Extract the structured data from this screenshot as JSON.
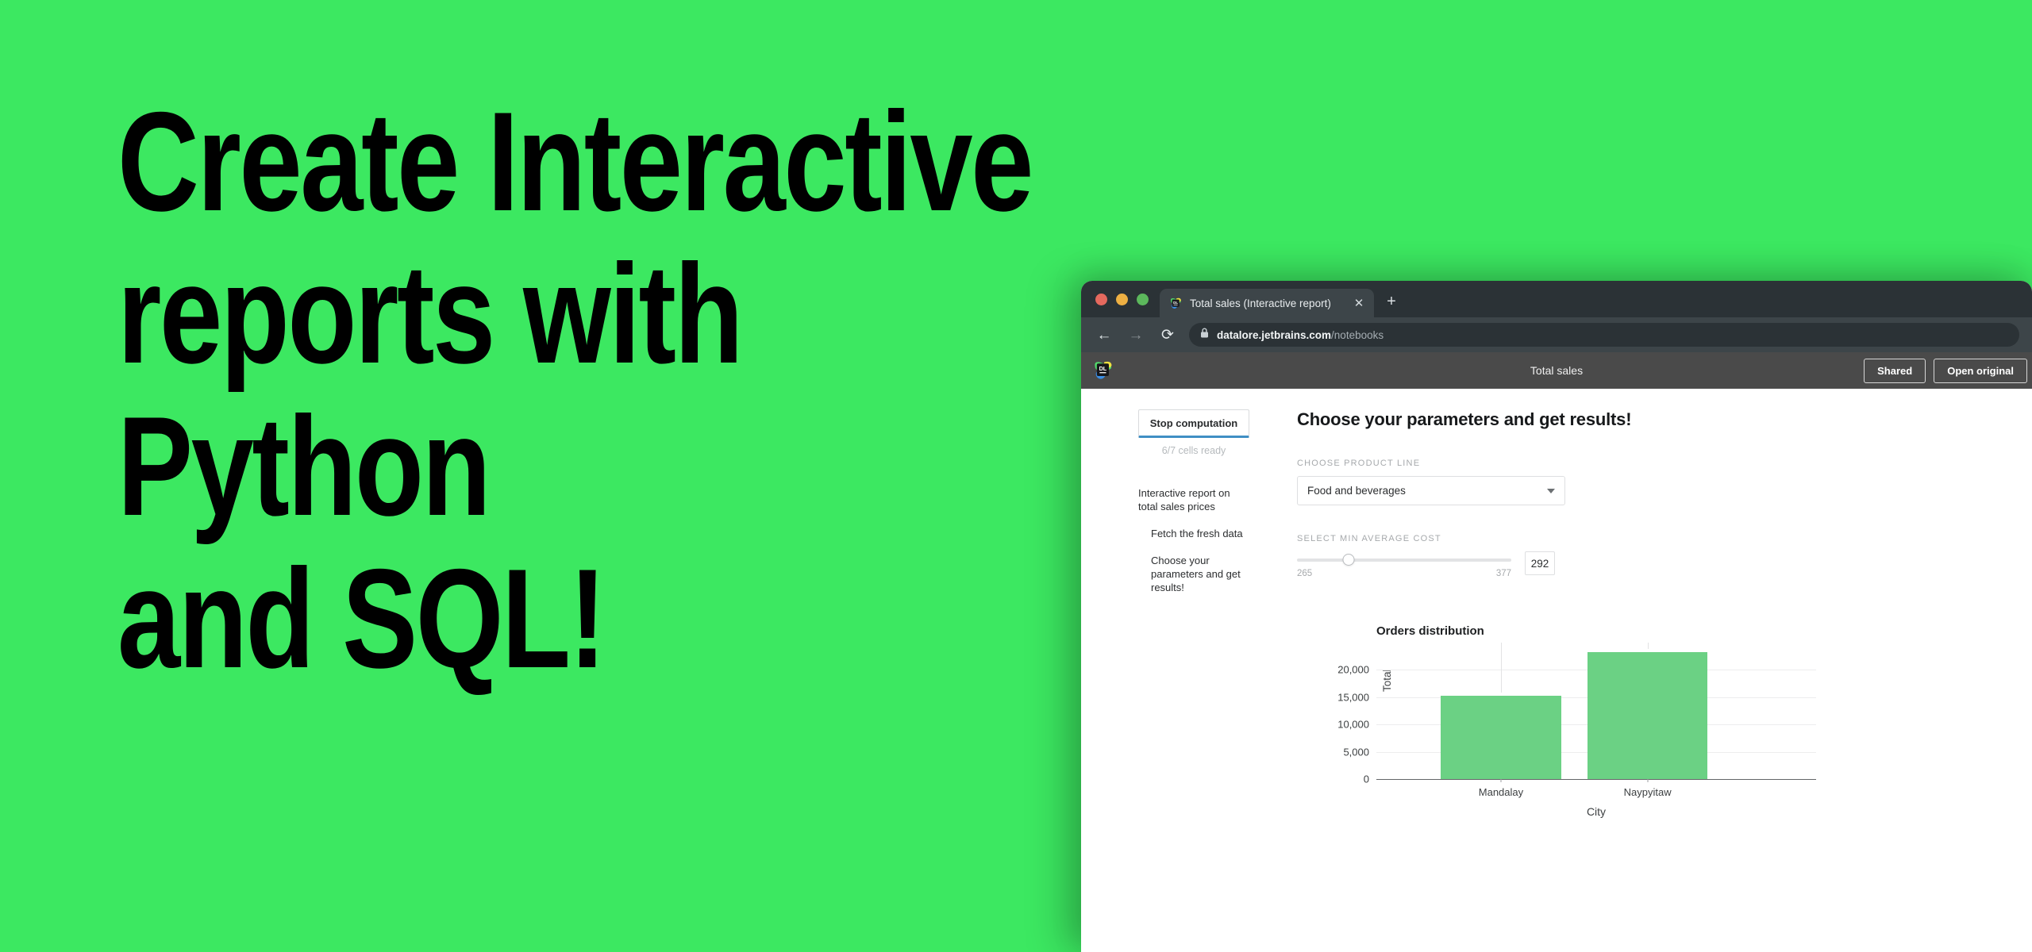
{
  "hero": {
    "lines": [
      "Create Interactive",
      "reports with",
      "Python",
      "and SQL!"
    ],
    "background_color": "#3ce861",
    "text_color": "#000000"
  },
  "browser": {
    "traffic_lights": [
      "close-red",
      "minimize-yellow",
      "maximize-green"
    ],
    "traffic_colors": {
      "red": "#e5695e",
      "yellow": "#eeb043",
      "green": "#5cb85c"
    },
    "tab": {
      "favicon": "datalore-icon",
      "title": "Total sales (Interactive report)",
      "close_label": "✕"
    },
    "new_tab_label": "+",
    "nav": {
      "back_label": "←",
      "forward_label": "→",
      "reload_label": "⟳"
    },
    "omnibox": {
      "lock_icon": "lock-icon",
      "domain": "datalore.jetbrains.com",
      "path": "/notebooks"
    },
    "chrome_color": "#2b3236",
    "toolbar_color": "#3d4549"
  },
  "app_header": {
    "logo": "datalore-logo",
    "title": "Total sales",
    "shared_label": "Shared",
    "open_original_label": "Open original",
    "background_color": "#4a4a4a"
  },
  "sidebar": {
    "stop_button_label": "Stop computation",
    "cells_ready": "6/7 cells ready",
    "toc": [
      {
        "level": 1,
        "label": "Interactive report on total sales prices"
      },
      {
        "level": 2,
        "label": "Fetch the fresh data"
      },
      {
        "level": 2,
        "label": "Choose your parameters and get results!"
      }
    ],
    "progress_color": "#3f8fc4"
  },
  "content": {
    "title": "Choose your parameters and get results!",
    "product_line": {
      "label": "CHOOSE PRODUCT LINE",
      "value": "Food and beverages",
      "caret": "chevron-down-icon"
    },
    "min_average_cost": {
      "label": "SELECT MIN AVERAGE COST",
      "min": "265",
      "max": "377",
      "value": "292"
    }
  },
  "chart_data": {
    "type": "bar",
    "title": "Orders distribution",
    "categories": [
      "Mandalay",
      "Naypyitaw"
    ],
    "values": [
      15300,
      23200
    ],
    "xlabel": "City",
    "ylabel": "Total",
    "ylim": [
      0,
      25000
    ],
    "yticks": [
      0,
      5000,
      10000,
      15000,
      20000
    ],
    "ytick_labels": [
      "0",
      "5,000",
      "10,000",
      "15,000",
      "20,000"
    ],
    "grid": true,
    "legend": "none",
    "bar_color": "#6bd184"
  }
}
